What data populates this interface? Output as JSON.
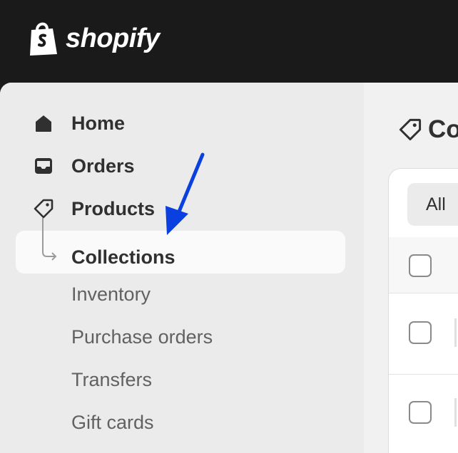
{
  "brand": {
    "name": "shopify"
  },
  "sidebar": {
    "items": [
      {
        "label": "Home",
        "icon": "home-icon"
      },
      {
        "label": "Orders",
        "icon": "inbox-icon"
      },
      {
        "label": "Products",
        "icon": "tag-icon"
      },
      {
        "label": "Collections",
        "active": true
      },
      {
        "label": "Inventory"
      },
      {
        "label": "Purchase orders"
      },
      {
        "label": "Transfers"
      },
      {
        "label": "Gift cards"
      }
    ]
  },
  "main": {
    "title": "Co",
    "title_icon": "tag-icon",
    "tabs": [
      {
        "label": "All"
      }
    ]
  },
  "annotation": {
    "color": "#0a3fe0"
  }
}
